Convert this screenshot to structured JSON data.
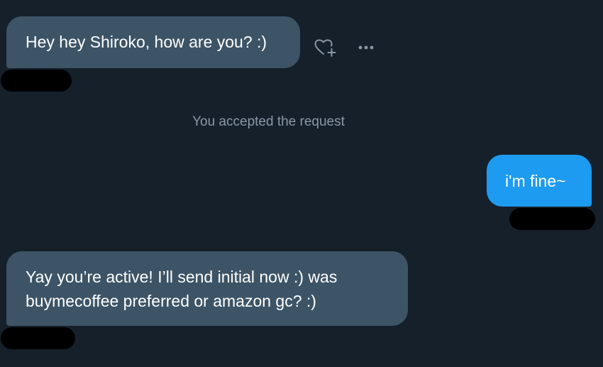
{
  "conversation": {
    "messages": [
      {
        "direction": "received",
        "text": "Hey hey Shiroko, how are you? :)"
      },
      {
        "direction": "sent",
        "text": "i'm fine~"
      },
      {
        "direction": "received",
        "text": "Yay you’re active! I’ll send initial now :) was buymecoffee preferred or amazon gc? :)"
      }
    ],
    "system_note": "You accepted the request"
  },
  "actions": {
    "react_icon": "heart-plus-icon",
    "more_icon": "more-horizontal-icon"
  },
  "colors": {
    "background": "#15202b",
    "received_bubble": "#3d5466",
    "sent_bubble": "#1d9bf0",
    "muted_text": "#8b98a5",
    "icon": "#8b98a5",
    "redaction": "#000000"
  }
}
